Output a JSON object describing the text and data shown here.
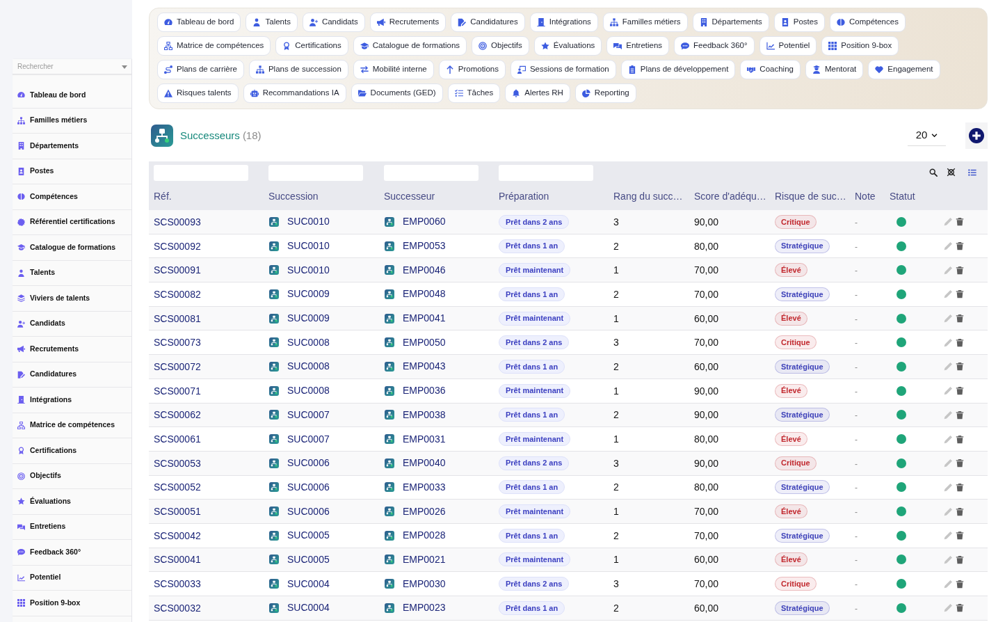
{
  "sidebar": {
    "search": {
      "placeholder": "Rechercher"
    },
    "items": [
      {
        "label": "Tableau de bord"
      },
      {
        "label": "Familles métiers"
      },
      {
        "label": "Départements"
      },
      {
        "label": "Postes"
      },
      {
        "label": "Compétences"
      },
      {
        "label": "Référentiel certifications"
      },
      {
        "label": "Catalogue de formations"
      },
      {
        "label": "Talents"
      },
      {
        "label": "Viviers de talents"
      },
      {
        "label": "Candidats"
      },
      {
        "label": "Recrutements"
      },
      {
        "label": "Candidatures"
      },
      {
        "label": "Intégrations"
      },
      {
        "label": "Matrice de compétences"
      },
      {
        "label": "Certifications"
      },
      {
        "label": "Objectifs"
      },
      {
        "label": "Évaluations"
      },
      {
        "label": "Entretiens"
      },
      {
        "label": "Feedback 360°"
      },
      {
        "label": "Potentiel"
      },
      {
        "label": "Position 9-box"
      }
    ]
  },
  "nav": {
    "rows": [
      {
        "buttons": [
          {
            "label": "Tableau de bord"
          },
          {
            "label": "Talents"
          },
          {
            "label": "Candidats"
          },
          {
            "label": "Recrutements"
          },
          {
            "label": "Candidatures"
          },
          {
            "label": "Intégrations"
          },
          {
            "label": "Familles métiers"
          },
          {
            "label": "Départements"
          },
          {
            "label": "Postes"
          },
          {
            "label": "Compétences"
          }
        ]
      },
      {
        "buttons": [
          {
            "label": "Matrice de compétences"
          },
          {
            "label": "Certifications"
          },
          {
            "label": "Catalogue de formations"
          },
          {
            "label": "Objectifs"
          },
          {
            "label": "Évaluations"
          },
          {
            "label": "Entretiens"
          },
          {
            "label": "Feedback 360°"
          },
          {
            "label": "Potentiel"
          },
          {
            "label": "Position 9-box"
          }
        ]
      },
      {
        "buttons": [
          {
            "label": "Plans de carrière"
          },
          {
            "label": "Plans de succession"
          },
          {
            "label": "Mobilité interne"
          },
          {
            "label": "Promotions"
          },
          {
            "label": "Sessions de formation"
          },
          {
            "label": "Plans de développement"
          },
          {
            "label": "Coaching"
          },
          {
            "label": "Mentorat"
          },
          {
            "label": "Engagement"
          }
        ]
      },
      {
        "buttons": [
          {
            "label": "Risques talents"
          },
          {
            "label": "Recommandations IA"
          },
          {
            "label": "Documents (GED)"
          },
          {
            "label": "Tâches"
          },
          {
            "label": "Alertes RH"
          },
          {
            "label": "Reporting"
          }
        ]
      }
    ]
  },
  "header": {
    "title": "Successeurs",
    "count": "(18)",
    "page_size": "20"
  },
  "table": {
    "columns": [
      {
        "label": "Réf.",
        "filterable": true
      },
      {
        "label": "Succession",
        "filterable": true
      },
      {
        "label": "Successeur",
        "filterable": true
      },
      {
        "label": "Préparation",
        "filterable": true
      },
      {
        "label": "Rang du succ…",
        "filterable": false
      },
      {
        "label": "Score d'adéqu…",
        "filterable": false
      },
      {
        "label": "Risque de suc…",
        "filterable": false
      },
      {
        "label": "Note",
        "filterable": false
      },
      {
        "label": "Statut",
        "filterable": false
      }
    ],
    "rows": [
      {
        "ref": "SCS00093",
        "succession": "SUC0010",
        "successor": "EMP0060",
        "preparation": "Prêt dans 2 ans",
        "rank": "3",
        "score": "90,00",
        "risk": {
          "label": "Critique",
          "color": "#c1272d"
        },
        "note": "-",
        "active": true
      },
      {
        "ref": "SCS00092",
        "succession": "SUC0010",
        "successor": "EMP0053",
        "preparation": "Prêt dans 1 an",
        "rank": "2",
        "score": "80,00",
        "risk": {
          "label": "Stratégique",
          "color": "#3b3fb8"
        },
        "note": "-",
        "active": true
      },
      {
        "ref": "SCS00091",
        "succession": "SUC0010",
        "successor": "EMP0046",
        "preparation": "Prêt maintenant",
        "rank": "1",
        "score": "70,00",
        "risk": {
          "label": "Élevé",
          "color": "#c1272d"
        },
        "note": "-",
        "active": true
      },
      {
        "ref": "SCS00082",
        "succession": "SUC0009",
        "successor": "EMP0048",
        "preparation": "Prêt dans 1 an",
        "rank": "2",
        "score": "70,00",
        "risk": {
          "label": "Stratégique",
          "color": "#3b3fb8"
        },
        "note": "-",
        "active": true
      },
      {
        "ref": "SCS00081",
        "succession": "SUC0009",
        "successor": "EMP0041",
        "preparation": "Prêt maintenant",
        "rank": "1",
        "score": "60,00",
        "risk": {
          "label": "Élevé",
          "color": "#c1272d"
        },
        "note": "-",
        "active": true
      },
      {
        "ref": "SCS00073",
        "succession": "SUC0008",
        "successor": "EMP0050",
        "preparation": "Prêt dans 2 ans",
        "rank": "3",
        "score": "70,00",
        "risk": {
          "label": "Critique",
          "color": "#c1272d"
        },
        "note": "-",
        "active": true
      },
      {
        "ref": "SCS00072",
        "succession": "SUC0008",
        "successor": "EMP0043",
        "preparation": "Prêt dans 1 an",
        "rank": "2",
        "score": "60,00",
        "risk": {
          "label": "Stratégique",
          "color": "#3b3fb8"
        },
        "note": "-",
        "active": true
      },
      {
        "ref": "SCS00071",
        "succession": "SUC0008",
        "successor": "EMP0036",
        "preparation": "Prêt maintenant",
        "rank": "1",
        "score": "90,00",
        "risk": {
          "label": "Élevé",
          "color": "#c1272d"
        },
        "note": "-",
        "active": true
      },
      {
        "ref": "SCS00062",
        "succession": "SUC0007",
        "successor": "EMP0038",
        "preparation": "Prêt dans 1 an",
        "rank": "2",
        "score": "90,00",
        "risk": {
          "label": "Stratégique",
          "color": "#3b3fb8"
        },
        "note": "-",
        "active": true
      },
      {
        "ref": "SCS00061",
        "succession": "SUC0007",
        "successor": "EMP0031",
        "preparation": "Prêt maintenant",
        "rank": "1",
        "score": "80,00",
        "risk": {
          "label": "Élevé",
          "color": "#c1272d"
        },
        "note": "-",
        "active": true
      },
      {
        "ref": "SCS00053",
        "succession": "SUC0006",
        "successor": "EMP0040",
        "preparation": "Prêt dans 2 ans",
        "rank": "3",
        "score": "90,00",
        "risk": {
          "label": "Critique",
          "color": "#c1272d"
        },
        "note": "-",
        "active": true
      },
      {
        "ref": "SCS00052",
        "succession": "SUC0006",
        "successor": "EMP0033",
        "preparation": "Prêt dans 1 an",
        "rank": "2",
        "score": "80,00",
        "risk": {
          "label": "Stratégique",
          "color": "#3b3fb8"
        },
        "note": "-",
        "active": true
      },
      {
        "ref": "SCS00051",
        "succession": "SUC0006",
        "successor": "EMP0026",
        "preparation": "Prêt maintenant",
        "rank": "1",
        "score": "70,00",
        "risk": {
          "label": "Élevé",
          "color": "#c1272d"
        },
        "note": "-",
        "active": true
      },
      {
        "ref": "SCS00042",
        "succession": "SUC0005",
        "successor": "EMP0028",
        "preparation": "Prêt dans 1 an",
        "rank": "2",
        "score": "70,00",
        "risk": {
          "label": "Stratégique",
          "color": "#3b3fb8"
        },
        "note": "-",
        "active": true
      },
      {
        "ref": "SCS00041",
        "succession": "SUC0005",
        "successor": "EMP0021",
        "preparation": "Prêt maintenant",
        "rank": "1",
        "score": "60,00",
        "risk": {
          "label": "Élevé",
          "color": "#c1272d"
        },
        "note": "-",
        "active": true
      },
      {
        "ref": "SCS00033",
        "succession": "SUC0004",
        "successor": "EMP0030",
        "preparation": "Prêt dans 2 ans",
        "rank": "3",
        "score": "70,00",
        "risk": {
          "label": "Critique",
          "color": "#c1272d"
        },
        "note": "-",
        "active": true
      },
      {
        "ref": "SCS00032",
        "succession": "SUC0004",
        "successor": "EMP0023",
        "preparation": "Prêt dans 1 an",
        "rank": "2",
        "score": "60,00",
        "risk": {
          "label": "Stratégique",
          "color": "#3b3fb8"
        },
        "note": "-",
        "active": true
      }
    ]
  }
}
